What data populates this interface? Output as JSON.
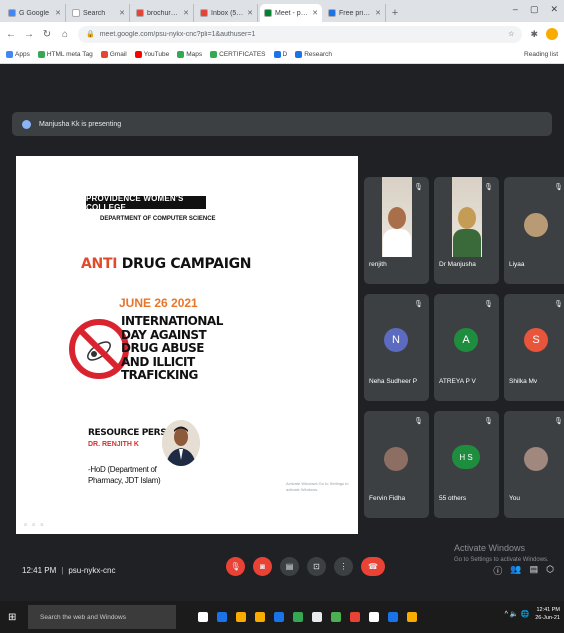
{
  "browser": {
    "tabs": [
      {
        "label": "G Google",
        "favicon_color": "#4285f4",
        "active": false
      },
      {
        "label": "Search",
        "favicon_color": "#ffffff",
        "active": false
      },
      {
        "label": "brochure - shanmyo",
        "favicon_color": "#ea4335",
        "active": false
      },
      {
        "label": "Inbox (59) - cyshan",
        "favicon_color": "#ea4335",
        "active": false
      },
      {
        "label": "Meet - psu-nyko",
        "favicon_color": "#00832d",
        "active": true
      },
      {
        "label": "Free printable poster",
        "favicon_color": "#1a73e8",
        "active": false
      }
    ],
    "new_tab": "+",
    "window_controls": [
      "–",
      "▢",
      "✕"
    ],
    "url": "meet.google.com/psu-nykx-cnc?pli=1&authuser=1",
    "bookmarks": [
      {
        "label": "Apps",
        "color": "#4285f4"
      },
      {
        "label": "HTML meta Tag",
        "color": "#34a853"
      },
      {
        "label": "Gmail",
        "color": "#ea4335"
      },
      {
        "label": "YouTube",
        "color": "#ff0000"
      },
      {
        "label": "Maps",
        "color": "#34a853"
      },
      {
        "label": "CERTIFICATES",
        "color": "#34a853"
      },
      {
        "label": "D",
        "color": "#1a73e8"
      },
      {
        "label": "Research",
        "color": "#1a73e8"
      }
    ],
    "reading_list": "Reading list"
  },
  "meet": {
    "presenting_text": "Manjusha Kk is presenting",
    "slide": {
      "college": "PROVIDENCE WOMEN'S COLLEGE",
      "department": "DEPARTMENT OF COMPUTER SCIENCE",
      "anti": "ANTI",
      "campaign": "DRUG CAMPAIGN",
      "date": "JUNE 26 2021",
      "day_title": "INTERNATIONAL DAY AGAINST DRUG ABUSE AND ILLICIT TRAFICKING",
      "resource_label": "RESOURCE PERSON:",
      "resource_name": "DR. RENJITH K",
      "resource_role": "-HoD (Department of Pharmacy, JDT Islam)",
      "watermark": "Activate Windows Go to Settings to activate Windows.",
      "footer": "a a a"
    },
    "participants": [
      {
        "name": "renjith",
        "kind": "photo",
        "color": "#a86f4a"
      },
      {
        "name": "Dr Manjusha",
        "kind": "photo",
        "color": "#c59c55"
      },
      {
        "name": "Liyaa",
        "kind": "pic",
        "color": "#b89a74"
      },
      {
        "name": "Neha Sudheer P",
        "kind": "initial",
        "initial": "N",
        "color": "#5c6bc0"
      },
      {
        "name": "ATREYA P V",
        "kind": "initial",
        "initial": "A",
        "color": "#1e8e3e"
      },
      {
        "name": "Shilka Mv",
        "kind": "initial",
        "initial": "S",
        "color": "#e8553b"
      },
      {
        "name": "Fervin Fidha",
        "kind": "pic",
        "color": "#8d6e63"
      },
      {
        "name": "55 others",
        "kind": "others",
        "initial": "H S",
        "color": "#1e8e3e"
      },
      {
        "name": "You",
        "kind": "pic",
        "color": "#a1887f"
      }
    ],
    "mic_icon": "🎙",
    "time": "12:41 PM",
    "meeting_code": "psu-nykx-cnc",
    "controls": [
      {
        "name": "mic-off-button",
        "glyph": "🎙",
        "style": "red"
      },
      {
        "name": "camera-off-button",
        "glyph": "◙",
        "style": "red"
      },
      {
        "name": "captions-button",
        "glyph": "▤",
        "style": ""
      },
      {
        "name": "present-button",
        "glyph": "⊡",
        "style": ""
      },
      {
        "name": "more-options-button",
        "glyph": "⋮",
        "style": ""
      },
      {
        "name": "leave-call-button",
        "glyph": "☎",
        "style": "end"
      }
    ],
    "right_controls": [
      "ⓘ",
      "👥",
      "▤",
      "⬡"
    ],
    "activate_title": "Activate Windows",
    "activate_sub": "Go to Settings to activate Windows."
  },
  "taskbar": {
    "search_placeholder": "Search the web and Windows",
    "apps": [
      "#ffffff",
      "#1a73e8",
      "#f9ab00",
      "#f9ab00",
      "#1a73e8",
      "#34a853",
      "#e8eaed",
      "#4caf50",
      "#ea4335",
      "#ffffff",
      "#1a73e8",
      "#f9ab00"
    ],
    "tray": "^ 🔈 🌐",
    "clock_time": "12:41 PM",
    "clock_date": "26-Jun-21"
  }
}
